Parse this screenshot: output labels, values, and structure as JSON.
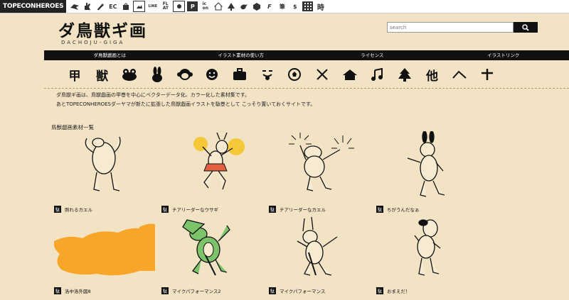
{
  "topbar": {
    "brand": "TOPECONHEROES",
    "icons": [
      "crow-icon",
      "hand-icon",
      "pen-icon",
      "ec",
      "bag-icon",
      "image-icon",
      "line",
      "flat",
      "ab-icon",
      "p-icon",
      "icon",
      "house-icon",
      "tree-icon",
      "bird-icon",
      "hex-icon",
      "f-icon",
      "fude",
      "yen-icon",
      "grid-icon",
      "ji"
    ],
    "icon_texts": [
      "",
      "",
      "",
      "EC",
      "",
      "",
      "LINE",
      "FL\nAT",
      "",
      "P",
      "ic\non",
      "",
      "",
      "",
      "",
      "F",
      "筆",
      "$",
      "",
      ""
    ]
  },
  "header": {
    "logo": "ダ鳥獣ギ画",
    "logo_sub": "DACHOJU-GIGA",
    "search_placeholder": "search"
  },
  "nav": [
    "ダ鳥獣戯画とは",
    "イラスト素材の使い方",
    "ライセンス",
    "イラストリンク"
  ],
  "category_icons": [
    "甲",
    "獣",
    "frog",
    "rabbit",
    "monkey",
    "smile",
    "bag",
    "tongue",
    "ball",
    "cross",
    "house",
    "note",
    "tree",
    "他",
    "mountain",
    "plus"
  ],
  "intro": {
    "line1": "ダ鳥獣ギ画は、鳥獣戯画の甲巻を中心にベクターデータ化、カラー化した素材集です。",
    "line2": "あとTOPECONHEROESダーヤマが新たに拡張した鳥獣戯画イラストを駄巻として こっそり置いておくサイトです。"
  },
  "section_title": "鳥獣戯画素材一覧",
  "tag_label": "駄",
  "items": [
    {
      "caption": "照れるカエル"
    },
    {
      "caption": "チアリーダーなウサギ"
    },
    {
      "caption": "チアリーダーなカエル"
    },
    {
      "caption": "ちがうんだなぁ"
    },
    {
      "caption": "洛中洛外図8"
    },
    {
      "caption": "マイクパフォーマンス2"
    },
    {
      "caption": "マイクパフォーマンス"
    },
    {
      "caption": "おまえだ！"
    }
  ]
}
